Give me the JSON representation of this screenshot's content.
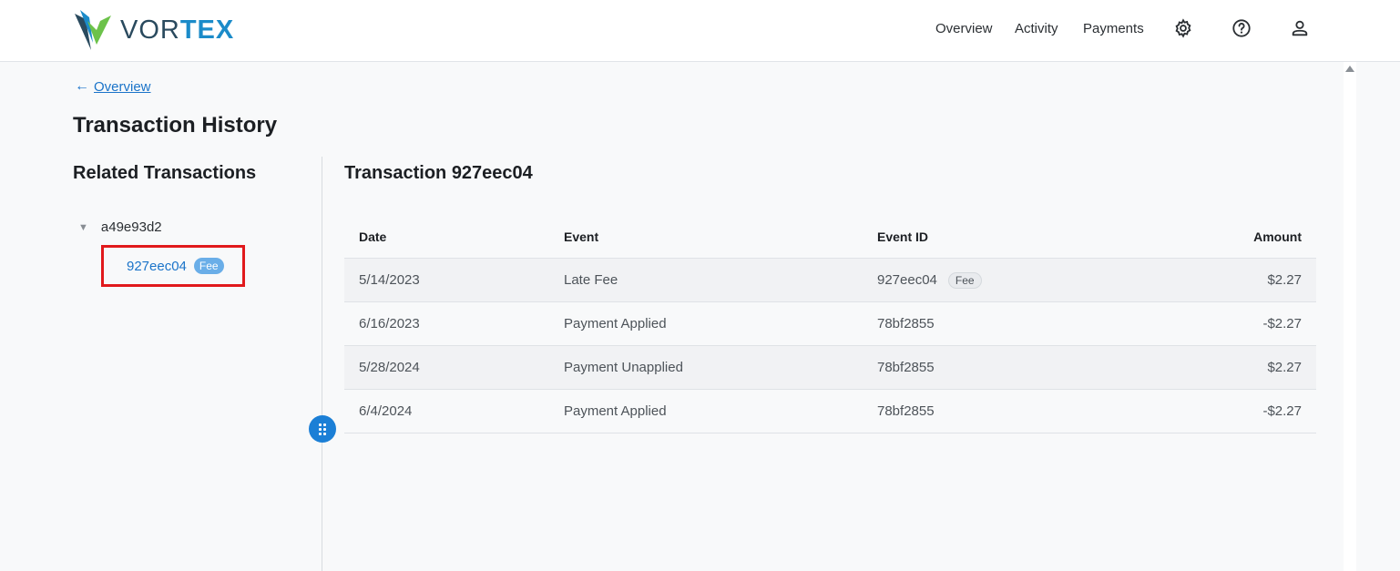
{
  "brand": {
    "text_a": "VOR",
    "text_b": "TEX"
  },
  "nav": {
    "links": [
      "Overview",
      "Activity",
      "Payments"
    ],
    "icons": [
      "gear-icon",
      "help-icon",
      "user-icon"
    ]
  },
  "breadcrumb": {
    "back_label": "Overview"
  },
  "page_title": "Transaction History",
  "related": {
    "title": "Related Transactions",
    "parent_id": "a49e93d2",
    "child_id": "927eec04",
    "child_badge": "Fee"
  },
  "detail": {
    "title": "Transaction 927eec04",
    "columns": {
      "date": "Date",
      "event": "Event",
      "event_id": "Event ID",
      "amount": "Amount"
    },
    "rows": [
      {
        "date": "5/14/2023",
        "event": "Late Fee",
        "event_id": "927eec04",
        "badge": "Fee",
        "amount": "$2.27"
      },
      {
        "date": "6/16/2023",
        "event": "Payment Applied",
        "event_id": "78bf2855",
        "amount": "-$2.27"
      },
      {
        "date": "5/28/2024",
        "event": "Payment Unapplied",
        "event_id": "78bf2855",
        "amount": "$2.27"
      },
      {
        "date": "6/4/2024",
        "event": "Payment Applied",
        "event_id": "78bf2855",
        "amount": "-$2.27"
      }
    ]
  },
  "colors": {
    "accent": "#1b7fd6",
    "highlight": "#e1191c",
    "brand_green": "#6cc24a",
    "brand_blue": "#1b8bc9"
  }
}
